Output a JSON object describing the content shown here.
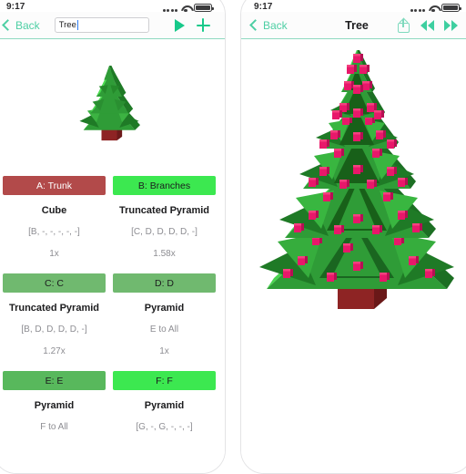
{
  "status_bar": {
    "time": "9:17",
    "signal_icon": "signal-dots-icon",
    "wifi_icon": "wifi-icon",
    "battery_icon": "battery-icon"
  },
  "left_panel": {
    "nav": {
      "back_label": "Back",
      "search_value": "Tree",
      "run_icon": "play-icon",
      "add_icon": "plus-icon"
    },
    "preview": {
      "model_name": "tree-model-small"
    },
    "cards": [
      {
        "badge": "A: Trunk",
        "badge_bg": "#b24a4a",
        "badge_fg": "#ffffff",
        "shape": "Cube",
        "rule": "[B, -, -, -, -, -]",
        "scale": "1x"
      },
      {
        "badge": "B: Branches",
        "badge_bg": "#3ce850",
        "badge_fg": "#1c1c1e",
        "shape": "Truncated Pyramid",
        "rule": "[C, D, D, D, D, -]",
        "scale": "1.58x"
      },
      {
        "badge": "C: C",
        "badge_bg": "#70b96f",
        "badge_fg": "#1c1c1e",
        "shape": "Truncated Pyramid",
        "rule": "[B, D, D, D, D, -]",
        "scale": "1.27x"
      },
      {
        "badge": "D: D",
        "badge_bg": "#70b96f",
        "badge_fg": "#1c1c1e",
        "shape": "Pyramid",
        "rule": "E to All",
        "scale": "1x"
      },
      {
        "badge": "E: E",
        "badge_bg": "#58b85c",
        "badge_fg": "#1c1c1e",
        "shape": "Pyramid",
        "rule": "F to All",
        "scale": ""
      },
      {
        "badge": "F: F",
        "badge_bg": "#3ce850",
        "badge_fg": "#1c1c1e",
        "shape": "Pyramid",
        "rule": "[G, -, G, -, -, -]",
        "scale": ""
      }
    ]
  },
  "right_panel": {
    "nav": {
      "back_label": "Back",
      "title": "Tree",
      "share_icon": "share-icon",
      "rewind_icon": "rewind-icon",
      "forward_icon": "fast-forward-icon"
    },
    "render": {
      "model_name": "tree-model-large"
    }
  },
  "theme": {
    "accent": "#17c98a",
    "tint": "#4ecfa4",
    "trunk": "#8e2424",
    "foliage_dark": "#1f7a26",
    "foliage_mid": "#2f9c37",
    "foliage_light": "#3ce850",
    "ornament": "#e8186a"
  }
}
